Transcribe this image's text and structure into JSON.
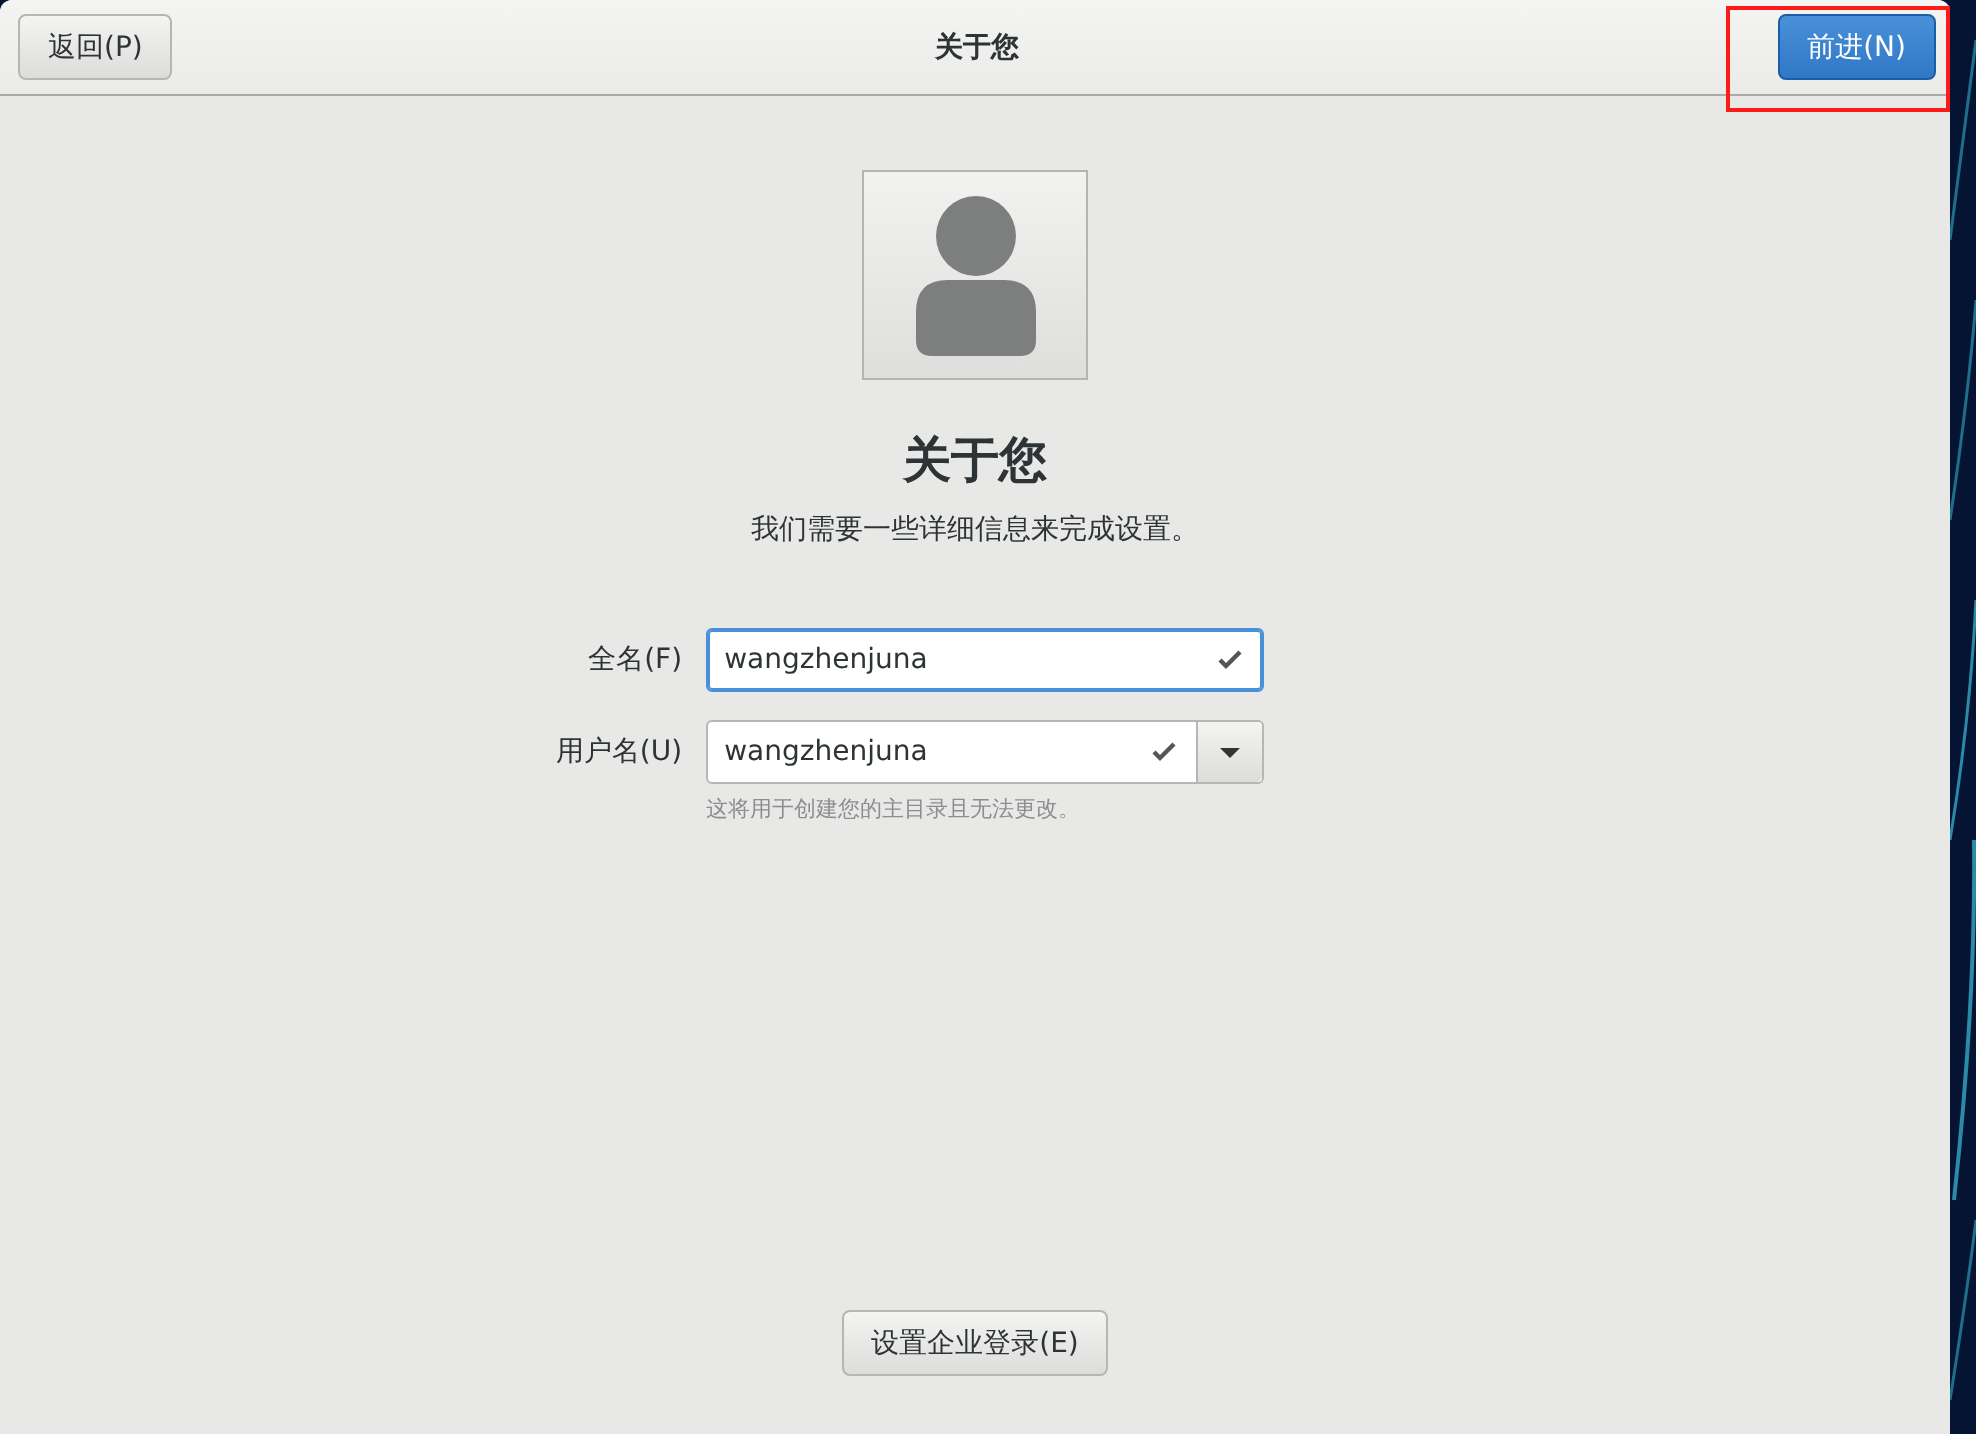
{
  "header": {
    "title": "关于您",
    "back_button": {
      "label": "返回(P)"
    },
    "next_button": {
      "label": "前进(N)",
      "highlighted": true
    }
  },
  "avatar": {
    "kind": "placeholder"
  },
  "heading": "关于您",
  "subtitle": "我们需要一些详细信息来完成设置。",
  "fields": [
    {
      "label": "全名(F)",
      "value": "wangzhenjuna",
      "focused": true,
      "valid": true,
      "kind": "text"
    },
    {
      "label": "用户名(U)",
      "value": "wangzhenjuna",
      "focused": false,
      "valid": true,
      "kind": "combo",
      "hint": "这将用于创建您的主目录且无法更改。"
    }
  ],
  "enterprise_button": {
    "label": "设置企业登录(E)"
  }
}
